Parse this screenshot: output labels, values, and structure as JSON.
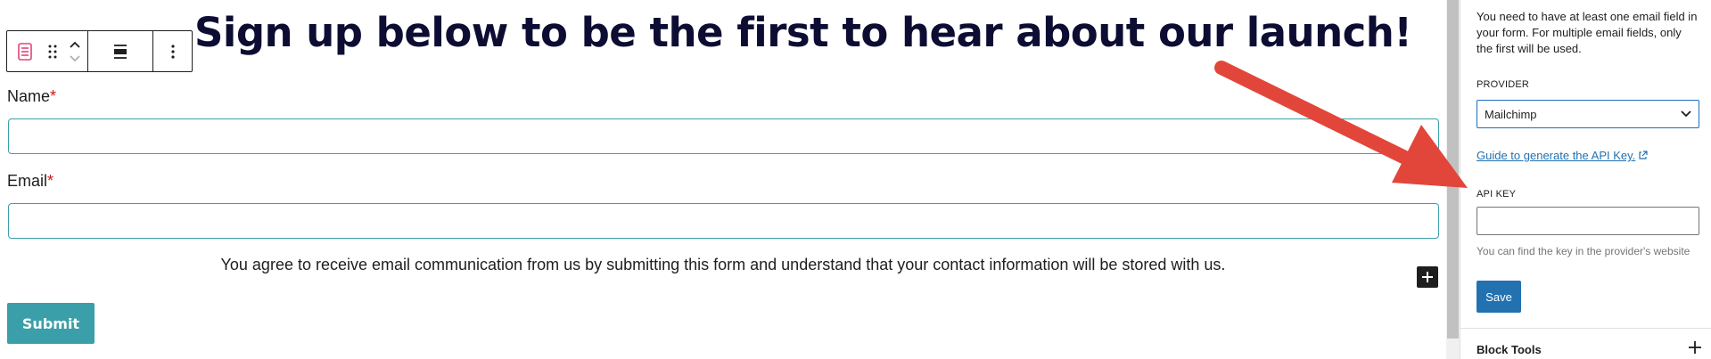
{
  "editor": {
    "heading": "Sign up below to be the first to hear about our launch!",
    "fields": [
      {
        "label": "Name",
        "required_mark": "*"
      },
      {
        "label": "Email",
        "required_mark": "*"
      }
    ],
    "consent_text": "You agree to receive email communication from us by submitting this form and understand that your contact information will be stored with us.",
    "submit_label": "Submit",
    "accent_color": "#3a9fa8"
  },
  "toolbar": {
    "icons": [
      "form-block-icon",
      "drag-handle-icon",
      "move-up-icon",
      "move-down-icon",
      "align-icon",
      "more-options-icon"
    ]
  },
  "sidebar": {
    "hint": "You need to have at least one email field in your form. For multiple email fields, only the first will be used.",
    "provider_label": "PROVIDER",
    "provider_value": "Mailchimp",
    "guide_link": "Guide to generate the API Key.",
    "api_key_label": "API KEY",
    "api_key_value": "",
    "api_key_help": "You can find the key in the provider's website",
    "save_label": "Save",
    "block_tools_label": "Block Tools",
    "primary_color": "#2271b1"
  },
  "annotation": {
    "arrow_color": "#e2463a"
  }
}
